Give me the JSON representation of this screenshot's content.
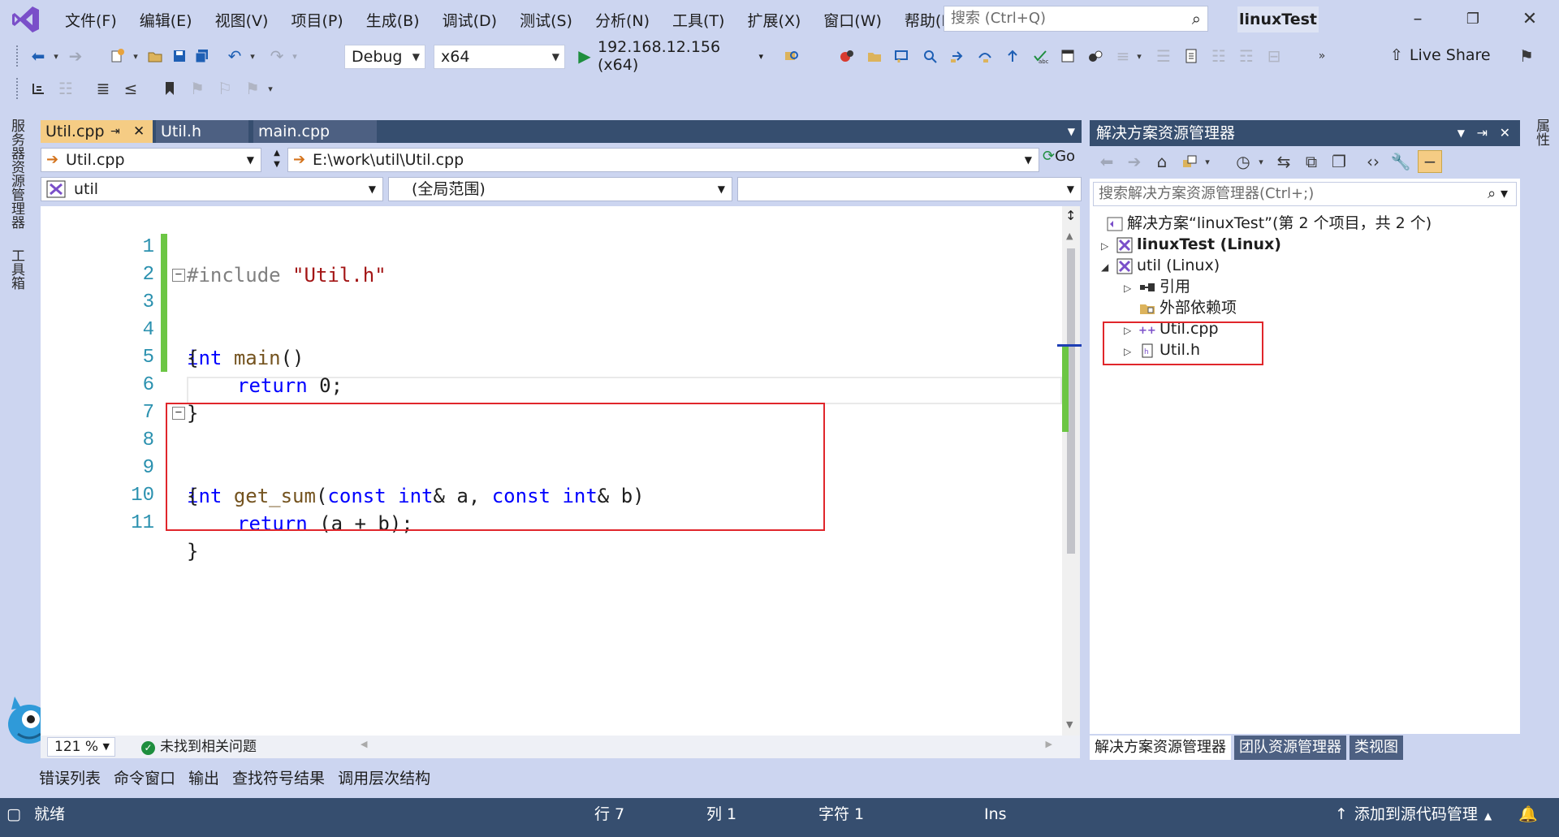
{
  "menu": {
    "items": [
      "文件(F)",
      "编辑(E)",
      "视图(V)",
      "项目(P)",
      "生成(B)",
      "调试(D)",
      "测试(S)",
      "分析(N)",
      "工具(T)",
      "扩展(X)",
      "窗口(W)",
      "帮助(H)"
    ],
    "search_placeholder": "搜索 (Ctrl+Q)",
    "project_name": "linuxTest"
  },
  "toolbar": {
    "config": "Debug",
    "platform": "x64",
    "run_target": "192.168.12.156 (x64)",
    "live_share": "Live Share"
  },
  "side_strip": {
    "server_explorer": "服务器资源管理器",
    "toolbox": "工具箱",
    "properties": "属性"
  },
  "doc_tabs": [
    {
      "label": "Util.cpp",
      "active": true
    },
    {
      "label": "Util.h",
      "active": false
    },
    {
      "label": "main.cpp",
      "active": false
    }
  ],
  "nav": {
    "file": "Util.cpp",
    "path": "E:\\work\\util\\Util.cpp",
    "go": "Go",
    "project": "util",
    "scope": "(全局范围)"
  },
  "code": {
    "line_numbers": [
      "1",
      "2",
      "3",
      "4",
      "5",
      "6",
      "7",
      "8",
      "9",
      "10",
      "11"
    ],
    "l1_directive": "#include",
    "l1_header": "\"Util.h\"",
    "l3_type": "int",
    "l3_name": "main",
    "l3_rest": "()",
    "l4": "{",
    "l5_kw": "return",
    "l5_rest": " 0;",
    "l6": "}",
    "l8_type": "int",
    "l8_name": "get_sum",
    "l8_p1": "(",
    "l8_const1": "const",
    "l8_int1": "int",
    "l8_p2": "& a, ",
    "l8_const2": "const",
    "l8_int2": "int",
    "l8_p3": "& b)",
    "l9": "{",
    "l10_kw": "return",
    "l10_rest": " (a + b);",
    "l11": "}"
  },
  "editor_footer": {
    "zoom": "121 %",
    "issues": "未找到相关问题"
  },
  "bottom_tabs": [
    "错误列表",
    "命令窗口",
    "输出",
    "查找符号结果",
    "调用层次结构"
  ],
  "status": {
    "ready": "就绪",
    "row": "行 7",
    "col": "列 1",
    "char": "字符 1",
    "mode": "Ins",
    "source_control": "添加到源代码管理"
  },
  "solution_explorer": {
    "title": "解决方案资源管理器",
    "search_placeholder": "搜索解决方案资源管理器(Ctrl+;)",
    "solution": "解决方案“linuxTest”(第 2 个项目，共 2 个)",
    "project1": "linuxTest (Linux)",
    "project2": "util (Linux)",
    "refs": "引用",
    "ext_deps": "外部依赖项",
    "file_cpp": "Util.cpp",
    "file_h": "Util.h",
    "tabs": [
      "解决方案资源管理器",
      "团队资源管理器",
      "类视图"
    ]
  },
  "colors": {
    "chrome": "#ccd5f0",
    "active_tab": "#f5cc84",
    "status_bar": "#364e6f",
    "highlight_box": "#e0262b",
    "keyword": "#0000ff",
    "string": "#a31515"
  }
}
